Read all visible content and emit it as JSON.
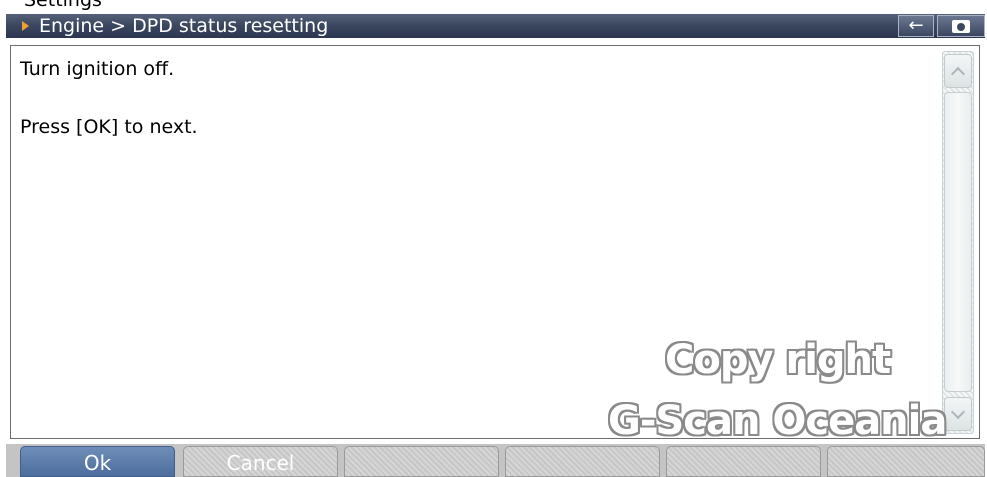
{
  "top_clipped_text": "Settings",
  "titlebar": {
    "title": "Engine > DPD status resetting",
    "back_icon": "←"
  },
  "messages": [
    "Turn ignition off.",
    "Press [OK] to next."
  ],
  "watermark": {
    "line1": "Copy right",
    "line2": "G-Scan Oceania"
  },
  "function_buttons": [
    {
      "label": "Ok"
    },
    {
      "label": "Cancel"
    },
    {
      "label": ""
    },
    {
      "label": ""
    },
    {
      "label": ""
    },
    {
      "label": ""
    }
  ],
  "colors": {
    "titlebar": "#3c4760",
    "title_arrow": "#f0a030",
    "ok_button": "#5b7aa8"
  },
  "icons": {
    "title_arrow": "caret-right-icon",
    "back": "back-arrow-icon",
    "camera": "camera-icon",
    "scroll_up": "chevron-up-icon",
    "scroll_down": "chevron-down-icon"
  }
}
